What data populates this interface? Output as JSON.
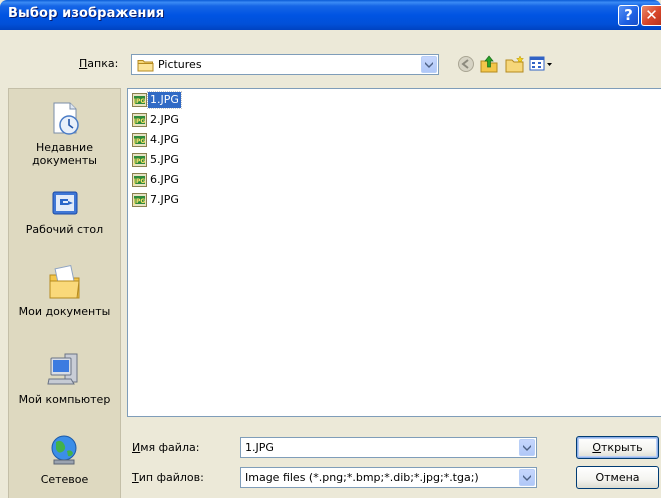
{
  "window": {
    "title": "Выбор изображения"
  },
  "titlebar": {
    "help_glyph": "?",
    "close_glyph": "✕"
  },
  "lookin": {
    "label_underlined": "П",
    "label_rest": "апка:",
    "value": "Pictures"
  },
  "places": [
    {
      "id": "recent",
      "label": "Недавние документы",
      "icon": "recent-documents-icon"
    },
    {
      "id": "desktop",
      "label": "Рабочий стол",
      "icon": "desktop-icon"
    },
    {
      "id": "mydocs",
      "label": "Мои документы",
      "icon": "my-documents-icon"
    },
    {
      "id": "mycomputer",
      "label": "Мой компьютер",
      "icon": "my-computer-icon"
    },
    {
      "id": "network",
      "label": "Сетевое",
      "icon": "network-icon"
    }
  ],
  "files": [
    {
      "name": "1.JPG",
      "selected": true
    },
    {
      "name": "2.JPG",
      "selected": false
    },
    {
      "name": "4.JPG",
      "selected": false
    },
    {
      "name": "5.JPG",
      "selected": false
    },
    {
      "name": "6.JPG",
      "selected": false
    },
    {
      "name": "7.JPG",
      "selected": false
    }
  ],
  "filename": {
    "label_underlined": "И",
    "label_rest": "мя файла:",
    "value": "1.JPG"
  },
  "filetype": {
    "label_underlined": "Т",
    "label_rest": "ип файлов:",
    "value": "Image files (*.png;*.bmp;*.dib;*.jpg;*.tga;)"
  },
  "buttons": {
    "open_underlined": "О",
    "open_rest": "ткрыть",
    "cancel": "Отмена"
  },
  "colors": {
    "titlebar": "#0054e3",
    "selection": "#316ac5",
    "dialog_bg": "#ece9d8"
  }
}
